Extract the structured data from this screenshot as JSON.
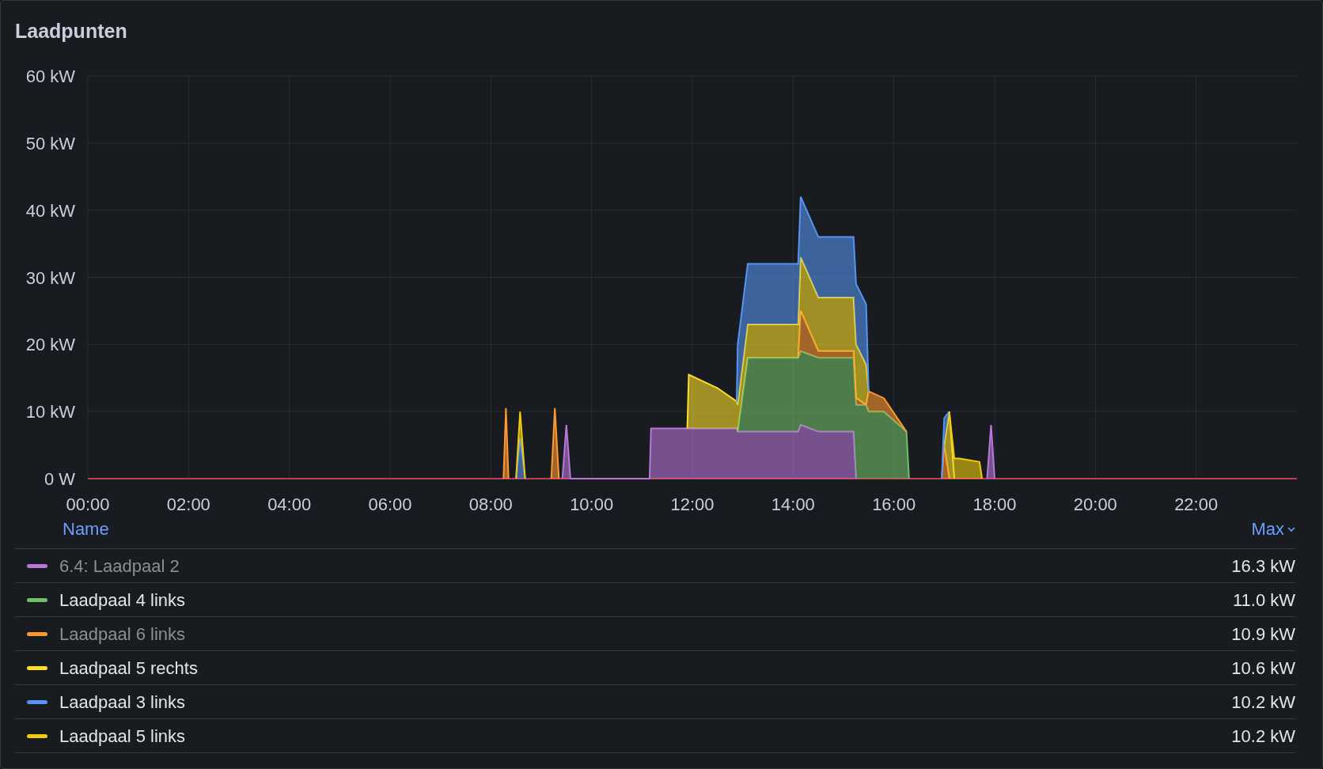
{
  "panel": {
    "title": "Laadpunten"
  },
  "chart_data": {
    "type": "area",
    "stacked": true,
    "grid": true,
    "x": [
      8.25,
      8.3,
      8.35,
      8.5,
      8.58,
      8.68,
      9.2,
      9.27,
      9.35,
      9.42,
      9.5,
      9.58,
      11.15,
      11.18,
      11.9,
      11.93,
      12.5,
      12.88,
      12.9,
      13.1,
      14.1,
      14.15,
      14.5,
      15.2,
      15.25,
      15.45,
      15.5,
      15.8,
      16.25,
      16.3,
      16.95,
      17.0,
      17.1,
      17.2,
      17.3,
      17.7,
      17.75,
      17.85,
      17.93,
      18.0
    ],
    "xlim": [
      0,
      24
    ],
    "ylim": [
      0,
      60
    ],
    "xticks": [
      {
        "value": 0,
        "label": "00:00"
      },
      {
        "value": 2,
        "label": "02:00"
      },
      {
        "value": 4,
        "label": "04:00"
      },
      {
        "value": 6,
        "label": "06:00"
      },
      {
        "value": 8,
        "label": "08:00"
      },
      {
        "value": 10,
        "label": "10:00"
      },
      {
        "value": 12,
        "label": "12:00"
      },
      {
        "value": 14,
        "label": "14:00"
      },
      {
        "value": 16,
        "label": "16:00"
      },
      {
        "value": 18,
        "label": "18:00"
      },
      {
        "value": 20,
        "label": "20:00"
      },
      {
        "value": 22,
        "label": "22:00"
      }
    ],
    "yticks": [
      {
        "value": 0,
        "label": "0 W"
      },
      {
        "value": 10,
        "label": "10 kW"
      },
      {
        "value": 20,
        "label": "20 kW"
      },
      {
        "value": 30,
        "label": "30 kW"
      },
      {
        "value": 40,
        "label": "40 kW"
      },
      {
        "value": 50,
        "label": "50 kW"
      },
      {
        "value": 60,
        "label": "60 kW"
      }
    ],
    "series": [
      {
        "color": "#b877d9",
        "values": [
          null,
          null,
          null,
          null,
          null,
          null,
          null,
          null,
          null,
          0,
          8,
          0,
          0,
          7.5,
          7.5,
          7.5,
          7.5,
          7.5,
          7,
          7,
          7,
          8,
          7,
          7,
          0,
          null,
          null,
          null,
          null,
          null,
          null,
          null,
          null,
          null,
          null,
          null,
          null,
          0,
          8,
          0
        ]
      },
      {
        "color": "#73bf69",
        "values": [
          null,
          null,
          null,
          null,
          null,
          null,
          null,
          null,
          null,
          null,
          null,
          null,
          null,
          null,
          null,
          null,
          null,
          null,
          0,
          11,
          11,
          11,
          11,
          11,
          11,
          11,
          10,
          10,
          7,
          0,
          null,
          null,
          null,
          null,
          null,
          null,
          null,
          null,
          null,
          null
        ]
      },
      {
        "color": "#ff9830",
        "values": [
          0,
          10.5,
          0,
          null,
          null,
          null,
          0,
          10.5,
          0,
          null,
          null,
          null,
          null,
          null,
          null,
          null,
          null,
          null,
          null,
          null,
          0,
          6,
          1,
          1,
          1,
          0,
          3,
          2,
          0,
          null,
          0,
          5,
          0,
          null,
          null,
          null,
          null,
          null,
          null,
          null
        ]
      },
      {
        "color": "#fade2a",
        "values": [
          null,
          null,
          null,
          null,
          null,
          null,
          null,
          null,
          null,
          null,
          null,
          null,
          null,
          null,
          0,
          8,
          6,
          4,
          4,
          5,
          5,
          8,
          8,
          8,
          8,
          6,
          0,
          null,
          null,
          null,
          null,
          0,
          10,
          0,
          null,
          null,
          null,
          null,
          null,
          null
        ]
      },
      {
        "color": "#5794f2",
        "values": [
          null,
          null,
          null,
          0,
          6,
          0,
          null,
          null,
          null,
          null,
          null,
          null,
          null,
          null,
          null,
          null,
          null,
          0,
          9,
          9,
          9,
          9,
          9,
          9,
          9,
          9,
          0,
          null,
          null,
          null,
          0,
          4,
          0,
          null,
          null,
          null,
          null,
          null,
          null,
          null
        ]
      },
      {
        "color": "#f2cc0c",
        "values": [
          null,
          null,
          null,
          0,
          4,
          0,
          null,
          null,
          null,
          null,
          null,
          null,
          null,
          null,
          null,
          null,
          null,
          null,
          null,
          null,
          null,
          null,
          null,
          null,
          null,
          null,
          null,
          null,
          null,
          null,
          null,
          null,
          0,
          3,
          3,
          2.5,
          0,
          null,
          null,
          null
        ]
      }
    ]
  },
  "legend": {
    "columns": [
      "Name",
      "Max"
    ],
    "items": [
      {
        "name": "6.4: Laadpaal 2",
        "max": "16.3 kW",
        "color": "#b877d9",
        "dimmed": true
      },
      {
        "name": "Laadpaal 4 links",
        "max": "11.0 kW",
        "color": "#73bf69",
        "dimmed": false
      },
      {
        "name": "Laadpaal 6 links",
        "max": "10.9 kW",
        "color": "#ff9830",
        "dimmed": true
      },
      {
        "name": "Laadpaal 5 rechts",
        "max": "10.6 kW",
        "color": "#fade2a",
        "dimmed": false
      },
      {
        "name": "Laadpaal 3 links",
        "max": "10.2 kW",
        "color": "#5794f2",
        "dimmed": false
      },
      {
        "name": "Laadpaal 5 links",
        "max": "10.2 kW",
        "color": "#f2cc0c",
        "dimmed": false
      }
    ]
  }
}
